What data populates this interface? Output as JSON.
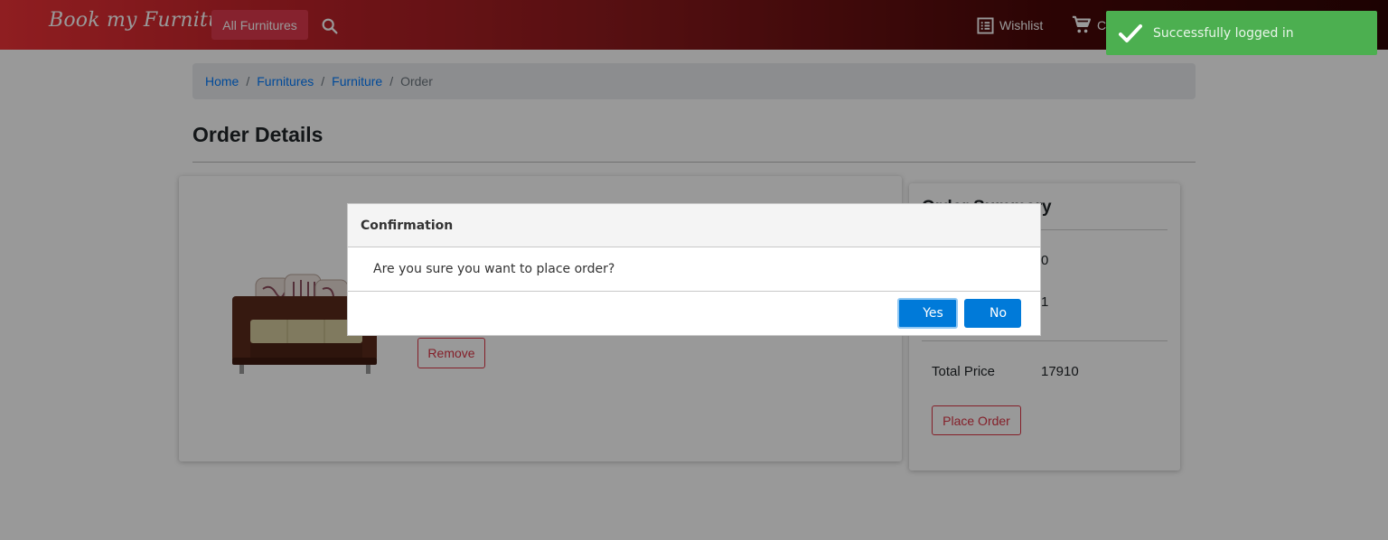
{
  "navbar": {
    "brand": "Book my Furniture",
    "all_furnitures": "All Furnitures",
    "wishlist": "Wishlist",
    "cart": "C"
  },
  "breadcrumb": {
    "items": [
      "Home",
      "Furnitures",
      "Furniture"
    ],
    "active": "Order",
    "separator": "/"
  },
  "page": {
    "title": "Order Details"
  },
  "product": {
    "remove_label": "Remove"
  },
  "summary": {
    "title": "Order Summary",
    "row1_value": "0",
    "row2_value": "1",
    "total_label": "Total Price",
    "total_value": "17910",
    "place_order_label": "Place Order"
  },
  "dialog": {
    "title": "Confirmation",
    "message": "Are you sure you want to place order?",
    "yes_label": "Yes",
    "no_label": "No"
  },
  "toast": {
    "message": "Successfully logged in"
  },
  "colors": {
    "brand_red": "#ef3237",
    "primary_blue": "#007ad9",
    "danger": "#dc3545",
    "success": "#4caf50"
  }
}
